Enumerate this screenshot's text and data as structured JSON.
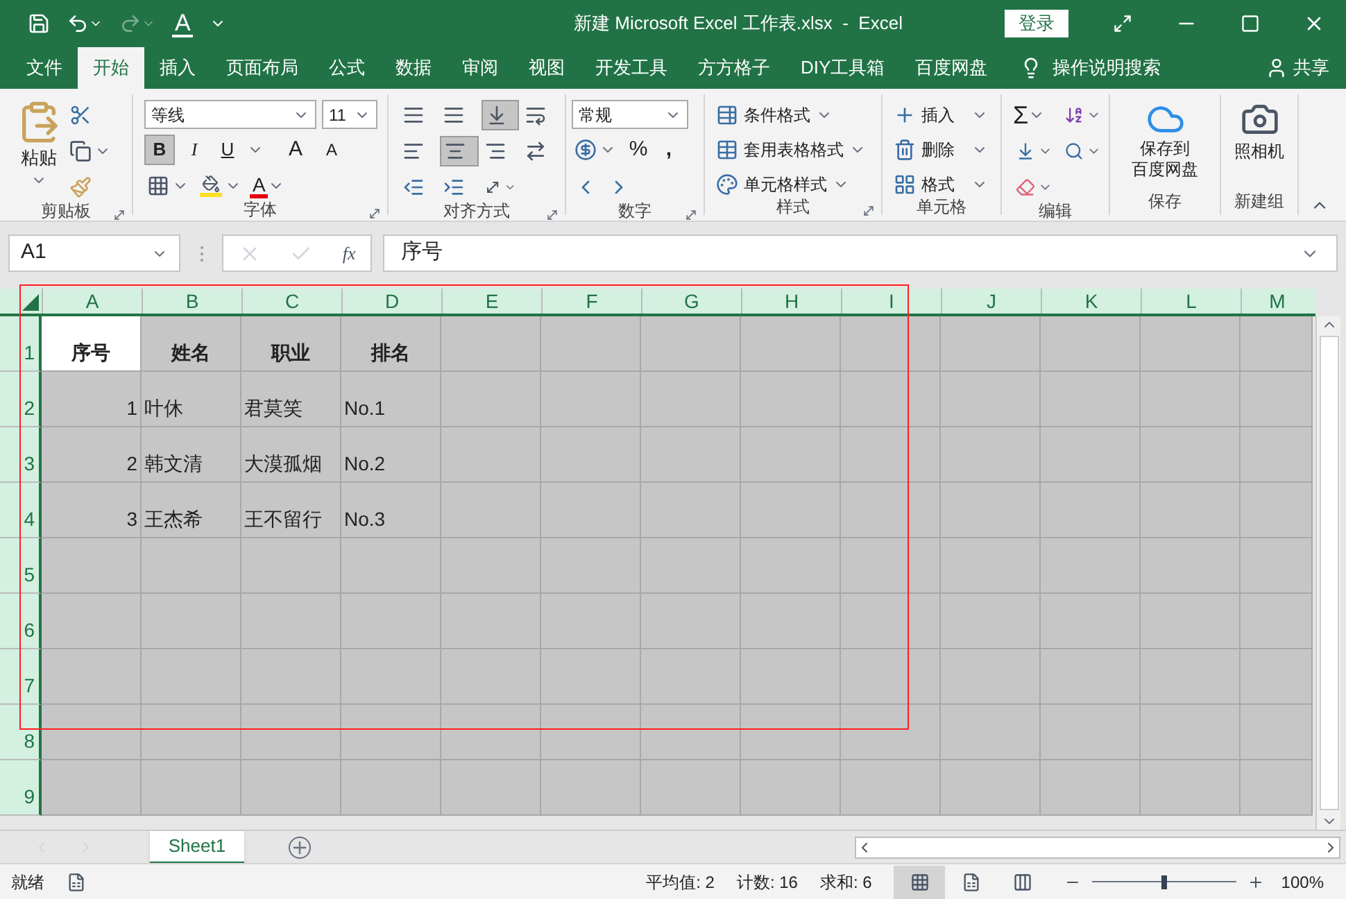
{
  "title_bar": {
    "title": "新建 Microsoft Excel 工作表.xlsx  -  Excel",
    "font_color_label": "A",
    "sign_in": "登录"
  },
  "menu_tabs": [
    {
      "label": "文件",
      "selected": false
    },
    {
      "label": "开始",
      "selected": true
    },
    {
      "label": "插入",
      "selected": false
    },
    {
      "label": "页面布局",
      "selected": false
    },
    {
      "label": "公式",
      "selected": false
    },
    {
      "label": "数据",
      "selected": false
    },
    {
      "label": "审阅",
      "selected": false
    },
    {
      "label": "视图",
      "selected": false
    },
    {
      "label": "开发工具",
      "selected": false
    },
    {
      "label": "方方格子",
      "selected": false
    },
    {
      "label": "DIY工具箱",
      "selected": false
    },
    {
      "label": "百度网盘",
      "selected": false
    }
  ],
  "tell_me": "操作说明搜索",
  "share": "共享",
  "ribbon": {
    "clipboard": {
      "paste": "粘贴",
      "label": "剪贴板"
    },
    "font": {
      "name": "等线",
      "size": "11",
      "bold_label": "B",
      "bold_on": true,
      "italic_label": "I",
      "underline_label": "U",
      "grow_label": "A",
      "shrink_label": "A",
      "color_label": "A",
      "label": "字体"
    },
    "alignment": {
      "bottom_on": true,
      "center_on": true,
      "label": "对齐方式"
    },
    "number": {
      "format": "常规",
      "percent": "%",
      "comma": ",",
      "label": "数字"
    },
    "styles": {
      "items": [
        "条件格式",
        "套用表格格式",
        "单元格样式"
      ],
      "label": "样式"
    },
    "cells": {
      "items": [
        "插入",
        "删除",
        "格式"
      ],
      "label": "单元格"
    },
    "editing": {
      "sum": "Σ",
      "label": "编辑"
    },
    "save": {
      "lines": [
        "保存到",
        "百度网盘"
      ],
      "label": "保存"
    },
    "camera": {
      "text": "照相机",
      "label": "新建组"
    }
  },
  "formula_bar": {
    "name_box": "A1",
    "fx": "fx",
    "value": "序号"
  },
  "columns": [
    "A",
    "B",
    "C",
    "D",
    "E",
    "F",
    "G",
    "H",
    "I",
    "J",
    "K",
    "L",
    "M"
  ],
  "rows": [
    {
      "label": "1",
      "cells": [
        {
          "text": "序号",
          "kind": "header",
          "selected": true
        },
        {
          "text": "姓名",
          "kind": "header",
          "selected": false
        },
        {
          "text": "职业",
          "kind": "header",
          "selected": false
        },
        {
          "text": "排名",
          "kind": "header",
          "selected": false
        }
      ]
    },
    {
      "label": "2",
      "cells": [
        {
          "text": "1",
          "kind": "number",
          "selected": false
        },
        {
          "text": "叶休",
          "kind": "text",
          "selected": false
        },
        {
          "text": "君莫笑",
          "kind": "text",
          "selected": false
        },
        {
          "text": "No.1",
          "kind": "text",
          "selected": false
        }
      ]
    },
    {
      "label": "3",
      "cells": [
        {
          "text": "2",
          "kind": "number",
          "selected": false
        },
        {
          "text": "韩文清",
          "kind": "text",
          "selected": false
        },
        {
          "text": "大漠孤烟",
          "kind": "text",
          "selected": false
        },
        {
          "text": "No.2",
          "kind": "text",
          "selected": false
        }
      ]
    },
    {
      "label": "4",
      "cells": [
        {
          "text": "3",
          "kind": "number",
          "selected": false
        },
        {
          "text": "王杰希",
          "kind": "text",
          "selected": false
        },
        {
          "text": "王不留行",
          "kind": "text",
          "selected": false
        },
        {
          "text": "No.3",
          "kind": "text",
          "selected": false
        }
      ]
    },
    {
      "label": "5"
    },
    {
      "label": "6"
    },
    {
      "label": "7"
    },
    {
      "label": "8"
    },
    {
      "label": "9"
    }
  ],
  "sheets": [
    {
      "label": "Sheet1",
      "selected": true
    }
  ],
  "status_bar": {
    "ready": "就绪",
    "average": "平均值: 2",
    "count": "计数: 16",
    "sum": "求和: 6",
    "views": [
      {
        "kind": "normal",
        "selected": true
      },
      {
        "kind": "page_layout",
        "selected": false
      },
      {
        "kind": "page_break",
        "selected": false
      }
    ],
    "zoom_slider": {
      "level": 0.5
    },
    "zoom": "100%"
  }
}
